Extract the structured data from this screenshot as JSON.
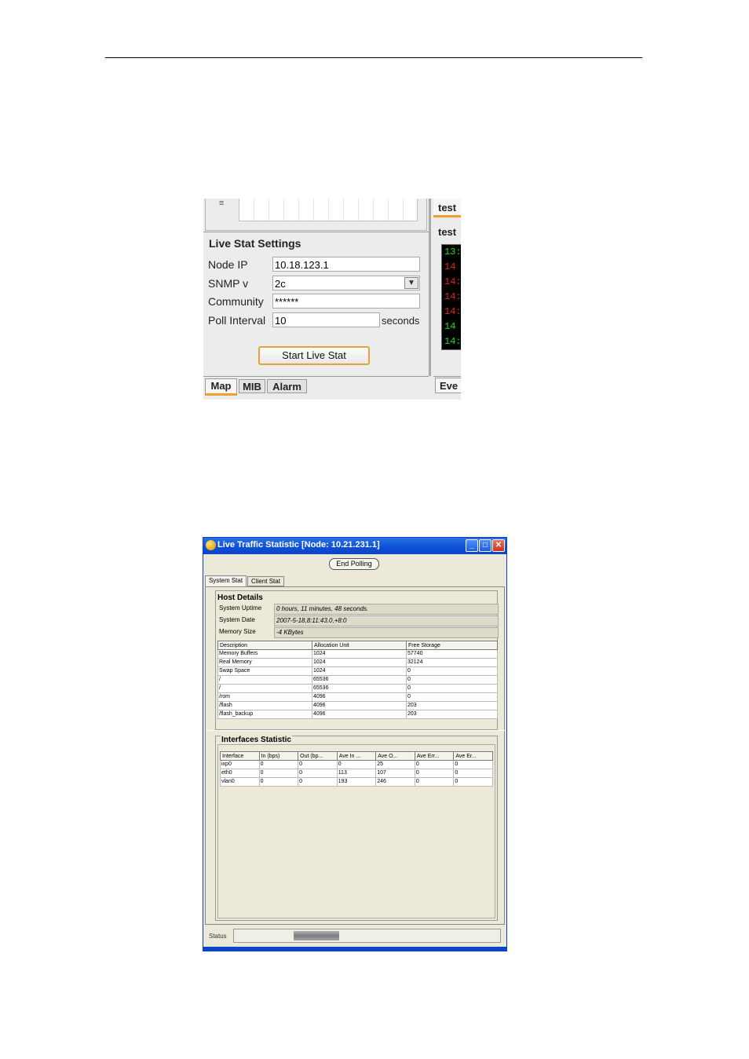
{
  "settings_panel": {
    "title": "Live Stat Settings",
    "fields": [
      {
        "label": "Node IP",
        "value": "10.18.123.1"
      },
      {
        "label": "SNMP v",
        "value": "2c"
      },
      {
        "label": "Community",
        "value": "******"
      },
      {
        "label": "Poll Interval",
        "value": "10",
        "suffix": "seconds"
      }
    ],
    "start_button": "Start Live Stat",
    "tabs": [
      "Map",
      "MIB",
      "Alarm"
    ],
    "active_tab": "Map",
    "right_tabs": [
      "test",
      "test"
    ],
    "console_lines": [
      {
        "text": "13:",
        "color": "#22dd22"
      },
      {
        "text": "14",
        "color": "#ee2222"
      },
      {
        "text": "14:",
        "color": "#ee2222"
      },
      {
        "text": "14:",
        "color": "#ee2222"
      },
      {
        "text": "14:",
        "color": "#ee2222"
      },
      {
        "text": "14",
        "color": "#22dd22"
      },
      {
        "text": "14:",
        "color": "#22dd22"
      }
    ],
    "right_bottom_tab": "Eve"
  },
  "traffic_window": {
    "title": "Live Traffic Statistic [Node: 10.21.231.1]",
    "end_polling": "End Polling",
    "tabs": [
      "System Stat",
      "Client Stat"
    ],
    "host_details": {
      "title": "Host Details",
      "rows": [
        {
          "key": "System Uptime",
          "value": "0 hours, 11 minutes, 48 seconds."
        },
        {
          "key": "System Date",
          "value": "2007-5-18,8:11:43.0,+8:0"
        },
        {
          "key": "Memory Size",
          "value": "-4 KBytes"
        }
      ],
      "storage_columns": [
        "Description",
        "Allocation Unit",
        "Free Storage"
      ],
      "storage_rows": [
        [
          "Memory Buffers",
          "1024",
          "57740"
        ],
        [
          "Real Memory",
          "1024",
          "32124"
        ],
        [
          "Swap Space",
          "1024",
          "0"
        ],
        [
          "/",
          "65536",
          "0"
        ],
        [
          "/",
          "65536",
          "0"
        ],
        [
          "/rom",
          "4096",
          "0"
        ],
        [
          "/flash",
          "4096",
          "203"
        ],
        [
          "/flash_backup",
          "4096",
          "203"
        ]
      ]
    },
    "interfaces": {
      "title": "Interfaces Statistic",
      "columns": [
        "Interface",
        "In (bps)",
        "Out (bp...",
        "Ave In ...",
        "Ave O...",
        "Ave Err...",
        "Ave Er..."
      ],
      "rows": [
        [
          "ixp0",
          "0",
          "0",
          "0",
          "25",
          "0",
          "0"
        ],
        [
          "eth0",
          "0",
          "0",
          "113",
          "107",
          "0",
          "0"
        ],
        [
          "vlan0",
          "0",
          "0",
          "193",
          "246",
          "0",
          "0"
        ]
      ]
    },
    "status_label": "Status",
    "status_progress": 0.22
  }
}
